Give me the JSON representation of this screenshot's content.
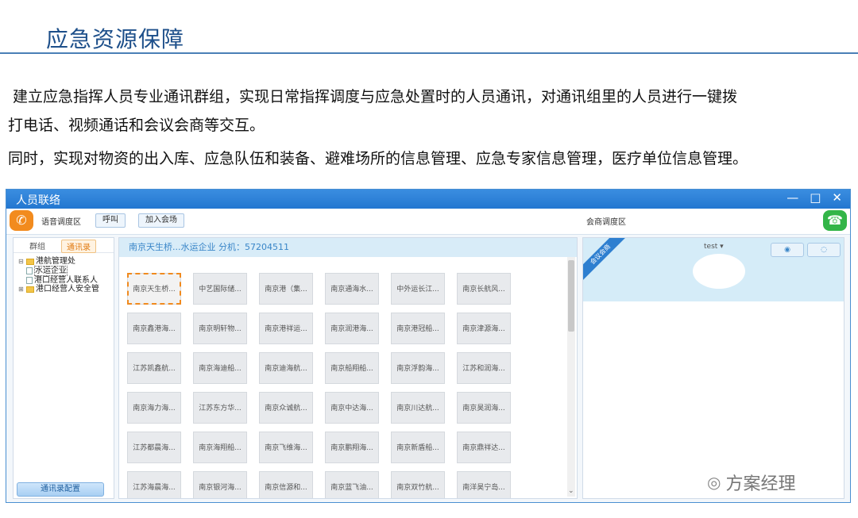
{
  "slide": {
    "title": "应急资源保障",
    "para1": "建立应急指挥人员专业通讯群组，实现日常指挥调度与应急处置时的人员通讯，对通讯组里的人员进行一键拨",
    "para2": "打电话、视频通话和会议会商等交互。",
    "para3": "同时，实现对物资的出入库、应急队伍和装备、避难场所的信息管理、应急专家信息管理，医疗单位信息管理。"
  },
  "window": {
    "title": "人员联络",
    "controls": [
      "—",
      "□",
      "✕"
    ]
  },
  "toolbar": {
    "left_label": "语音调度区",
    "call_button": "呼叫",
    "join_button": "加入会场",
    "right_label": "会商调度区"
  },
  "sidebar": {
    "tabs": [
      "群组",
      "通讯录"
    ],
    "active_tab": 1,
    "tree": [
      {
        "label": "港航管理处",
        "type": "folder",
        "expanded": true
      },
      {
        "label": "水运企业",
        "type": "doc",
        "selected": true
      },
      {
        "label": "港口经营人联系人",
        "type": "doc"
      },
      {
        "label": "港口经营人安全管",
        "type": "folder"
      }
    ],
    "bottom_button": "通讯录配置"
  },
  "center": {
    "header": "南京天生桥...水运企业   分机：57204511",
    "contacts": [
      "南京天生桥...",
      "中艺国际储...",
      "南京港（集...",
      "南京通海水...",
      "中外运长江...",
      "南京长航风...",
      "南京鑫港海...",
      "南京明轩物...",
      "南京港祥运...",
      "南京润港海...",
      "南京港冠船...",
      "南京津源海...",
      "江苏凯鑫航...",
      "南京海迪船...",
      "南京迪海航...",
      "南京船翔船...",
      "南京浮韵海...",
      "江苏和润海...",
      "南京海力海...",
      "江苏东方华...",
      "南京众诚航...",
      "南京中达海...",
      "南京川达航...",
      "南京昊润海...",
      "江苏都晨海...",
      "南京海翔船...",
      "南京飞维海...",
      "南京鹏翔海...",
      "南京新盾船...",
      "南京鼎祥达...",
      "江苏海晨海...",
      "南京银河海...",
      "南京信源和...",
      "南京蓝飞油...",
      "南京双竹航...",
      "南洋昊宁岛..."
    ],
    "selected_index": 0
  },
  "right": {
    "ribbon": "会议会商",
    "user": "test ▾",
    "btn1": "◉",
    "btn2": "◌"
  },
  "watermark": "方案经理",
  "colors": {
    "title": "#1d4f8a",
    "titlebar": "#2a80d6",
    "orange": "#f28b1e",
    "green": "#33b548"
  }
}
